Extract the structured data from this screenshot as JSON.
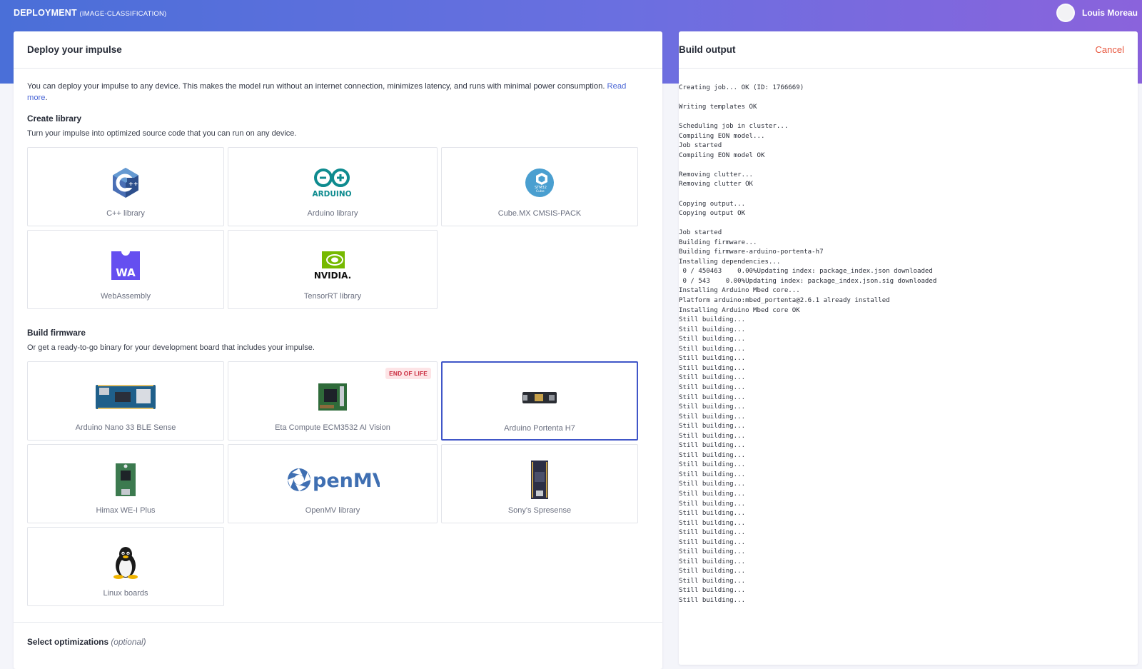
{
  "header": {
    "title": "DEPLOYMENT",
    "subtitle": "(IMAGE-CLASSIFICATION)",
    "user_name": "Louis Moreau"
  },
  "deploy": {
    "title": "Deploy your impulse",
    "intro": "You can deploy your impulse to any device. This makes the model run without an internet connection, minimizes latency, and runs with minimal power consumption.",
    "read_more": "Read more",
    "library": {
      "title": "Create library",
      "desc": "Turn your impulse into optimized source code that you can run on any device.",
      "items": [
        "C++ library",
        "Arduino library",
        "Cube.MX CMSIS-PACK",
        "WebAssembly",
        "TensorRT library"
      ]
    },
    "firmware": {
      "title": "Build firmware",
      "desc": "Or get a ready-to-go binary for your development board that includes your impulse.",
      "items": [
        "Arduino Nano 33 BLE Sense",
        "Eta Compute ECM3532 AI Vision",
        "Arduino Portenta H7",
        "Himax WE-I Plus",
        "OpenMV library",
        "Sony's Spresense",
        "Linux boards"
      ],
      "selected": "Arduino Portenta H7",
      "eol_badge": "END OF LIFE"
    },
    "optimizations": {
      "title": "Select optimizations",
      "optional": "(optional)"
    }
  },
  "build": {
    "title": "Build output",
    "cancel_label": "Cancel",
    "log_lines": [
      "Creating job... OK (ID: 1766669)",
      "",
      "Writing templates OK",
      "",
      "Scheduling job in cluster...",
      "Compiling EON model...",
      "Job started",
      "Compiling EON model OK",
      "",
      "Removing clutter...",
      "Removing clutter OK",
      "",
      "Copying output...",
      "Copying output OK",
      "",
      "Job started",
      "Building firmware...",
      "Building firmware-arduino-portenta-h7",
      "Installing dependencies...",
      " 0 / 450463    0.00%Updating index: package_index.json downloaded",
      " 0 / 543    0.00%Updating index: package_index.json.sig downloaded",
      "Installing Arduino Mbed core...",
      "Platform arduino:mbed_portenta@2.6.1 already installed",
      "Installing Arduino Mbed core OK",
      "Still building...",
      "Still building...",
      "Still building...",
      "Still building...",
      "Still building...",
      "Still building...",
      "Still building...",
      "Still building...",
      "Still building...",
      "Still building...",
      "Still building...",
      "Still building...",
      "Still building...",
      "Still building...",
      "Still building...",
      "Still building...",
      "Still building...",
      "Still building...",
      "Still building...",
      "Still building...",
      "Still building...",
      "Still building...",
      "Still building...",
      "Still building...",
      "Still building...",
      "Still building...",
      "Still building...",
      "Still building...",
      "Still building...",
      "Still building..."
    ]
  }
}
